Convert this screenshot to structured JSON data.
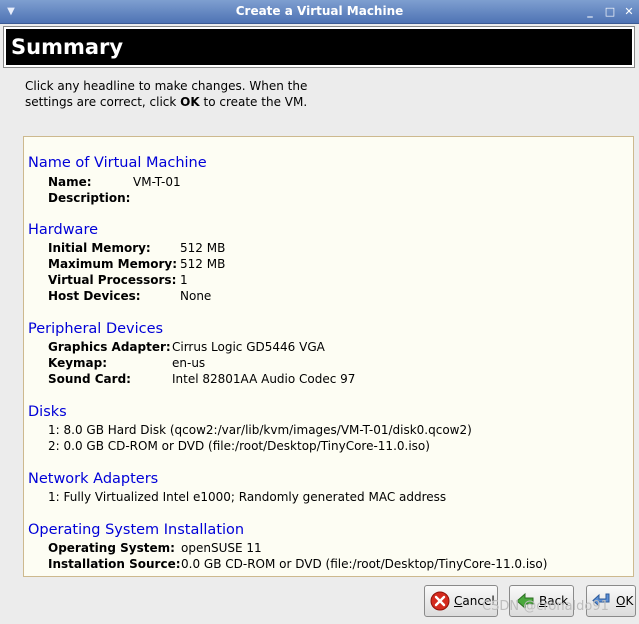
{
  "window": {
    "title": "Create a Virtual Machine",
    "menu_icon": "window-menu-icon",
    "minimize_glyph": "_",
    "maximize_glyph": "□",
    "close_glyph": "✕"
  },
  "banner": {
    "title": "Summary"
  },
  "intro": {
    "text_before": "Click any headline to make changes.  When the settings are correct, click ",
    "ok_word": "OK",
    "text_after": " to create the VM."
  },
  "sections": {
    "name": {
      "heading": "Name of Virtual Machine",
      "name_label": "Name:",
      "name_value": "VM-T-01",
      "desc_label": "Description:",
      "desc_value": ""
    },
    "hardware": {
      "heading": "Hardware",
      "init_mem_label": "Initial Memory:",
      "init_mem_value": "512 MB",
      "max_mem_label": "Maximum Memory:",
      "max_mem_value": "512 MB",
      "vcpu_label": "Virtual Processors:",
      "vcpu_value": "1",
      "hostdev_label": "Host Devices:",
      "hostdev_value": "None"
    },
    "peripheral": {
      "heading": "Peripheral Devices",
      "graphics_label": "Graphics Adapter:",
      "graphics_value": "Cirrus Logic GD5446 VGA",
      "keymap_label": "Keymap:",
      "keymap_value": "en-us",
      "sound_label": "Sound Card:",
      "sound_value": "Intel 82801AA Audio Codec 97"
    },
    "disks": {
      "heading": "Disks",
      "items": [
        "1: 8.0 GB Hard Disk (qcow2:/var/lib/kvm/images/VM-T-01/disk0.qcow2)",
        "2: 0.0 GB CD-ROM or DVD (file:/root/Desktop/TinyCore-11.0.iso)"
      ]
    },
    "network": {
      "heading": "Network Adapters",
      "items": [
        "1: Fully Virtualized Intel e1000; Randomly generated MAC address"
      ]
    },
    "os": {
      "heading": "Operating System Installation",
      "os_label": "Operating System:",
      "os_value": "openSUSE 11",
      "source_label": "Installation Source:",
      "source_value": "0.0 GB CD-ROM or DVD (file:/root/Desktop/TinyCore-11.0.iso)"
    }
  },
  "buttons": {
    "cancel": {
      "label_pre": "",
      "label_ul": "C",
      "label_post": "ancel",
      "icon": "cancel-icon"
    },
    "back": {
      "label_pre": "",
      "label_ul": "B",
      "label_post": "ack",
      "icon": "back-arrow-icon"
    },
    "ok": {
      "label_pre": "",
      "label_ul": "O",
      "label_post": "K",
      "icon": "ok-arrow-icon"
    }
  },
  "watermark": {
    "text": "CSDN @cronaldo91"
  },
  "colors": {
    "link": "#0000d8",
    "panel_bg": "#fdfdf3",
    "titlebar": "#5a7dbd"
  }
}
